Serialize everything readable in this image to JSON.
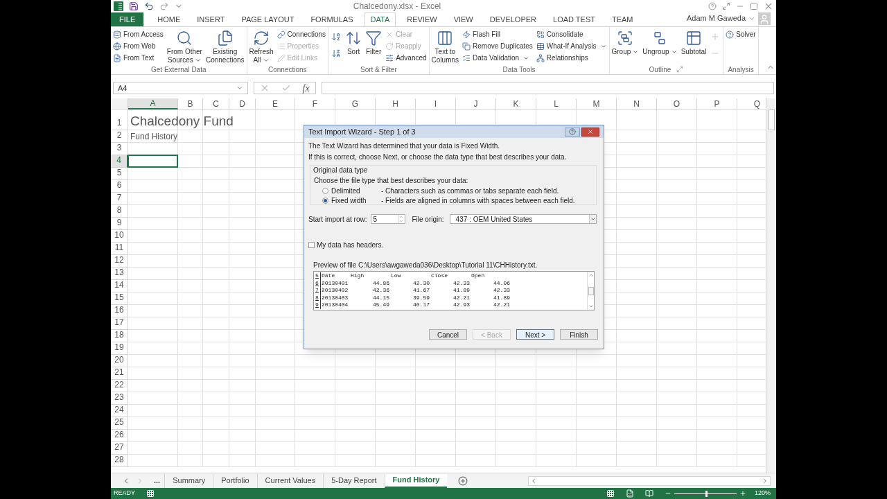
{
  "window": {
    "title": "Chalcedony.xlsx - Excel"
  },
  "ribbon_tabs": [
    {
      "label": "FILE",
      "kind": "file",
      "selected": false
    },
    {
      "label": "HOME",
      "kind": "tab",
      "selected": false
    },
    {
      "label": "INSERT",
      "kind": "tab",
      "selected": false
    },
    {
      "label": "PAGE LAYOUT",
      "kind": "tab",
      "selected": false
    },
    {
      "label": "FORMULAS",
      "kind": "tab",
      "selected": false
    },
    {
      "label": "DATA",
      "kind": "tab",
      "selected": true
    },
    {
      "label": "REVIEW",
      "kind": "tab",
      "selected": false
    },
    {
      "label": "VIEW",
      "kind": "tab",
      "selected": false
    },
    {
      "label": "DEVELOPER",
      "kind": "tab",
      "selected": false
    },
    {
      "label": "LOAD TEST",
      "kind": "tab",
      "selected": false
    },
    {
      "label": "TEAM",
      "kind": "tab",
      "selected": false
    }
  ],
  "user": {
    "name": "Adam M Gaweda"
  },
  "ribbon_groups": [
    {
      "label": "Get External Data",
      "columns": [
        [
          {
            "kind": "small",
            "label": "From Access",
            "disabled": false,
            "dropdown": false
          },
          {
            "kind": "small",
            "label": "From Web",
            "disabled": false,
            "dropdown": false
          },
          {
            "kind": "small",
            "label": "From Text",
            "disabled": false,
            "dropdown": false
          }
        ],
        [
          {
            "kind": "large",
            "lines": [
              "From Other",
              "Sources"
            ],
            "disabled": false,
            "dropdown": true
          }
        ],
        [
          {
            "kind": "large",
            "lines": [
              "Existing",
              "Connections"
            ],
            "disabled": false,
            "dropdown": false
          }
        ]
      ]
    },
    {
      "label": "Connections",
      "columns": [
        [
          {
            "kind": "large",
            "lines": [
              "Refresh",
              "All"
            ],
            "disabled": false,
            "dropdown": true
          }
        ],
        [
          {
            "kind": "small",
            "label": "Connections",
            "disabled": false,
            "dropdown": false
          },
          {
            "kind": "small",
            "label": "Properties",
            "disabled": true,
            "dropdown": false
          },
          {
            "kind": "small",
            "label": "Edit Links",
            "disabled": true,
            "dropdown": false
          }
        ]
      ]
    },
    {
      "label": "Sort & Filter",
      "columns": [
        [
          {
            "kind": "icon",
            "disabled": false
          },
          {
            "kind": "icon",
            "disabled": false
          }
        ],
        [
          {
            "kind": "large",
            "lines": [
              "Sort"
            ],
            "disabled": false,
            "dropdown": false
          }
        ],
        [
          {
            "kind": "large",
            "lines": [
              "Filter"
            ],
            "disabled": false,
            "dropdown": false
          }
        ],
        [
          {
            "kind": "small",
            "label": "Clear",
            "disabled": true,
            "dropdown": false
          },
          {
            "kind": "small",
            "label": "Reapply",
            "disabled": true,
            "dropdown": false
          },
          {
            "kind": "small",
            "label": "Advanced",
            "disabled": false,
            "dropdown": false
          }
        ]
      ]
    },
    {
      "label": "Data Tools",
      "columns": [
        [
          {
            "kind": "large",
            "lines": [
              "Text to",
              "Columns"
            ],
            "disabled": false,
            "dropdown": false
          }
        ],
        [
          {
            "kind": "small",
            "label": "Flash Fill",
            "disabled": false,
            "dropdown": false
          },
          {
            "kind": "small",
            "label": "Remove Duplicates",
            "disabled": false,
            "dropdown": false
          },
          {
            "kind": "small",
            "label": "Data Validation",
            "disabled": false,
            "dropdown": true
          }
        ],
        [
          {
            "kind": "small",
            "label": "Consolidate",
            "disabled": false,
            "dropdown": false
          },
          {
            "kind": "small",
            "label": "What-If Analysis",
            "disabled": false,
            "dropdown": true
          },
          {
            "kind": "small",
            "label": "Relationships",
            "disabled": false,
            "dropdown": false
          }
        ]
      ]
    },
    {
      "label": "Outline",
      "launcher": true,
      "columns": [
        [
          {
            "kind": "large",
            "lines": [
              "Group"
            ],
            "disabled": false,
            "dropdown": true
          }
        ],
        [
          {
            "kind": "large",
            "lines": [
              "Ungroup"
            ],
            "disabled": false,
            "dropdown": true
          }
        ],
        [
          {
            "kind": "large",
            "lines": [
              "Subtotal"
            ],
            "disabled": false,
            "dropdown": false
          }
        ],
        [
          {
            "kind": "icon",
            "disabled": true
          },
          {
            "kind": "icon",
            "disabled": true
          }
        ]
      ]
    },
    {
      "label": "Analysis",
      "columns": [
        [
          {
            "kind": "small",
            "label": "Solver",
            "disabled": false,
            "dropdown": false
          }
        ]
      ]
    }
  ],
  "formula_bar": {
    "name_box": "A4",
    "function_label": "fx"
  },
  "columns": [
    {
      "label": "A",
      "selected": true
    },
    {
      "label": "B",
      "selected": false
    },
    {
      "label": "C",
      "selected": false
    },
    {
      "label": "D",
      "selected": false
    },
    {
      "label": "E",
      "selected": false
    },
    {
      "label": "F",
      "selected": false
    },
    {
      "label": "G",
      "selected": false
    },
    {
      "label": "H",
      "selected": false
    },
    {
      "label": "I",
      "selected": false
    },
    {
      "label": "J",
      "selected": false
    },
    {
      "label": "K",
      "selected": false
    },
    {
      "label": "L",
      "selected": false
    },
    {
      "label": "M",
      "selected": false
    },
    {
      "label": "N",
      "selected": false
    },
    {
      "label": "O",
      "selected": false
    },
    {
      "label": "P",
      "selected": false
    },
    {
      "label": "Q",
      "selected": false
    }
  ],
  "rows": [
    {
      "label": "1",
      "selected": false,
      "cells": [
        {
          "text": "Chalcedony Fund",
          "kind": "title"
        }
      ]
    },
    {
      "label": "2",
      "selected": false,
      "cells": [
        {
          "text": "Fund History",
          "kind": "text"
        }
      ]
    },
    {
      "label": "3",
      "selected": false
    },
    {
      "label": "4",
      "selected": true
    },
    {
      "label": "5",
      "selected": false
    },
    {
      "label": "6",
      "selected": false
    },
    {
      "label": "7",
      "selected": false
    },
    {
      "label": "8",
      "selected": false
    },
    {
      "label": "9",
      "selected": false
    },
    {
      "label": "10",
      "selected": false
    },
    {
      "label": "11",
      "selected": false
    },
    {
      "label": "12",
      "selected": false
    },
    {
      "label": "13",
      "selected": false
    },
    {
      "label": "14",
      "selected": false
    },
    {
      "label": "15",
      "selected": false
    },
    {
      "label": "16",
      "selected": false
    },
    {
      "label": "17",
      "selected": false
    },
    {
      "label": "18",
      "selected": false
    },
    {
      "label": "19",
      "selected": false
    },
    {
      "label": "20",
      "selected": false
    },
    {
      "label": "21",
      "selected": false
    },
    {
      "label": "22",
      "selected": false
    },
    {
      "label": "23",
      "selected": false
    },
    {
      "label": "24",
      "selected": false
    },
    {
      "label": "25",
      "selected": false
    },
    {
      "label": "26",
      "selected": false
    },
    {
      "label": "27",
      "selected": false
    },
    {
      "label": "28",
      "selected": false
    }
  ],
  "dialog": {
    "title": "Text Import Wizard - Step 1 of 3",
    "messages": [
      "The Text Wizard has determined that your data is Fixed Width.",
      "If this is correct, choose Next, or choose the data type that best describes your data."
    ],
    "group_label": "Original data type",
    "prompt": "Choose the file type that best describes your data:",
    "options": [
      {
        "label": "Delimited",
        "description": "- Characters such as commas or tabs separate each field.",
        "selected": false
      },
      {
        "label": "Fixed width",
        "description": "- Fields are aligned in columns with spaces between each field.",
        "selected": true
      }
    ],
    "start_row": {
      "label": "Start import at row:",
      "value": "5"
    },
    "file_origin": {
      "label": "File origin:",
      "value": "437 : OEM United States"
    },
    "headers_checkbox": {
      "label": "My data has headers.",
      "checked": false
    },
    "preview_label": "Preview of file C:\\Users\\awgaweda036\\Desktop\\Tutorial 11\\CHHistory.txt.",
    "preview_rows": [
      {
        "number": "5",
        "kind": "header",
        "cells": [
          "Date",
          "High",
          "Low",
          "Close",
          "Open"
        ]
      },
      {
        "number": "6",
        "kind": "data",
        "cells": [
          "20130401",
          "44.86",
          "42.30",
          "42.33",
          "44.06"
        ]
      },
      {
        "number": "7",
        "kind": "data",
        "cells": [
          "20130402",
          "42.36",
          "41.67",
          "41.89",
          "42.33"
        ]
      },
      {
        "number": "8",
        "kind": "data",
        "cells": [
          "20130403",
          "44.15",
          "39.59",
          "42.21",
          "41.89"
        ]
      },
      {
        "number": "9",
        "kind": "data",
        "cells": [
          "20130404",
          "45.49",
          "40.17",
          "42.93",
          "42.21"
        ]
      }
    ],
    "buttons": [
      {
        "label": "Cancel",
        "disabled": false,
        "default": false
      },
      {
        "label": "< Back",
        "disabled": true,
        "default": false
      },
      {
        "label": "Next >",
        "disabled": false,
        "default": true
      },
      {
        "label": "Finish",
        "disabled": false,
        "default": false
      }
    ]
  },
  "sheet_tabs": [
    {
      "label": "...",
      "kind": "more",
      "selected": false
    },
    {
      "label": "Summary",
      "kind": "sheet",
      "selected": false
    },
    {
      "label": "Portfolio",
      "kind": "sheet",
      "selected": false
    },
    {
      "label": "Current Values",
      "kind": "sheet",
      "selected": false
    },
    {
      "label": "5-Day Report",
      "kind": "sheet",
      "selected": false
    },
    {
      "label": "Fund History",
      "kind": "sheet",
      "selected": true
    }
  ],
  "status_bar": {
    "status": "READY",
    "zoom_slider": {
      "level": 0.5
    },
    "zoom": "120%"
  }
}
